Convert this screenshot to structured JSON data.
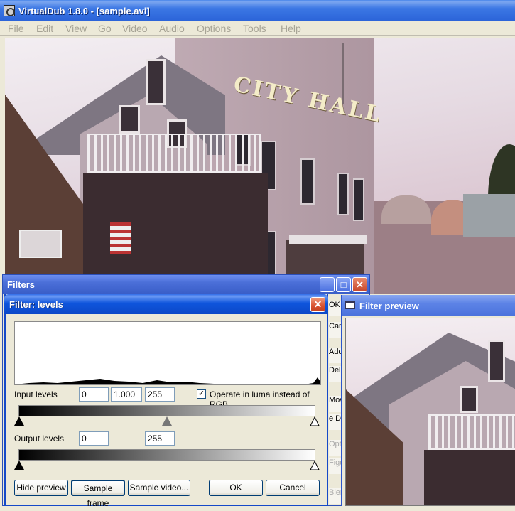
{
  "main_window": {
    "title": "VirtualDub 1.8.0 - [sample.avi]",
    "menu": [
      "File",
      "Edit",
      "View",
      "Go",
      "Video",
      "Audio",
      "Options",
      "Tools",
      "Help"
    ],
    "sign_text": "CITY HALL"
  },
  "filters_window": {
    "title": "Filters",
    "side_buttons": [
      "OK",
      "Canc",
      "Add..",
      "Dele",
      "Move",
      "e D",
      "Opti",
      "Figu",
      "Blen"
    ]
  },
  "levels_dialog": {
    "title": "Filter: levels",
    "input_label": "Input levels",
    "input_black": "0",
    "input_gamma": "1.000",
    "input_white": "255",
    "luma_checkbox_label": "Operate in luma instead of RGB",
    "luma_checked": true,
    "check_mark": "✓",
    "output_label": "Output levels",
    "output_black": "0",
    "output_white": "255",
    "close_glyph": "✕",
    "buttons": {
      "hide_preview": "Hide preview",
      "sample_frame": "Sample frame",
      "sample_video": "Sample video...",
      "ok": "OK",
      "cancel": "Cancel"
    }
  },
  "preview_window": {
    "title": "Filter preview"
  },
  "colors": {
    "titlebar_active": "#0b48c8",
    "titlebar_inactive": "#7ba6f0",
    "dialog_face": "#ece9d8",
    "close_red": "#d8512f"
  },
  "icons": [
    "app-icon",
    "minimize-icon",
    "maximize-icon",
    "close-icon",
    "black-point-marker-icon",
    "gamma-marker-icon",
    "white-point-marker-icon",
    "preview-window-icon"
  ]
}
